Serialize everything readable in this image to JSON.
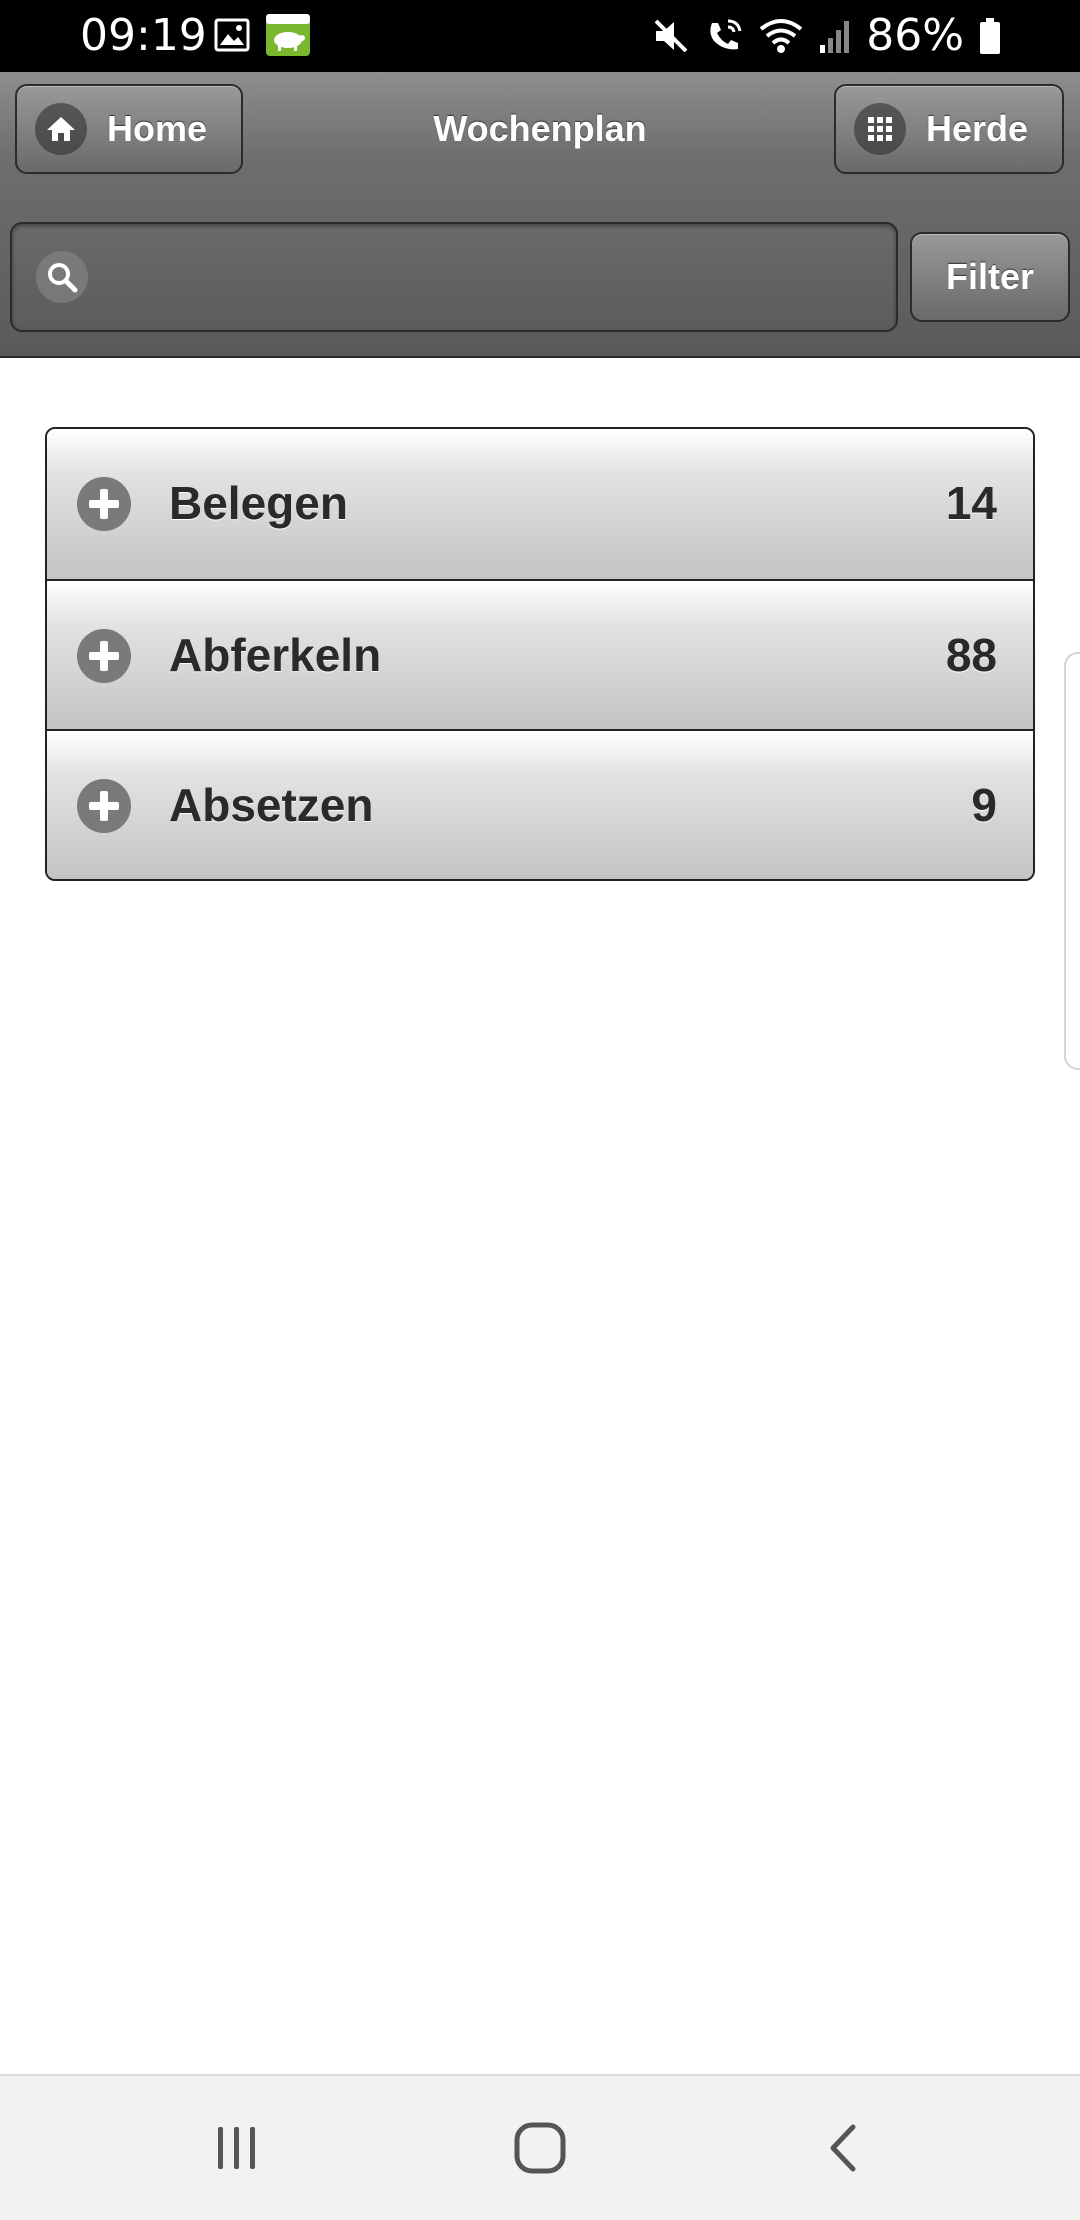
{
  "status_bar": {
    "time": "09:19",
    "battery": "86%"
  },
  "header": {
    "home_label": "Home",
    "title": "Wochenplan",
    "herde_label": "Herde"
  },
  "search": {
    "placeholder": "",
    "value": ""
  },
  "filter": {
    "label": "Filter"
  },
  "list": {
    "items": [
      {
        "label": "Belegen",
        "count": "14"
      },
      {
        "label": "Abferkeln",
        "count": "88"
      },
      {
        "label": "Absetzen",
        "count": "9"
      }
    ]
  },
  "icons": {
    "home": "home-icon",
    "herde": "grid-icon",
    "search": "search-icon",
    "expand": "plus-icon"
  },
  "colors": {
    "header_dark": "#5a5a5a",
    "header_light": "#8e8e8e",
    "app_icon_green": "#7cb82f"
  }
}
